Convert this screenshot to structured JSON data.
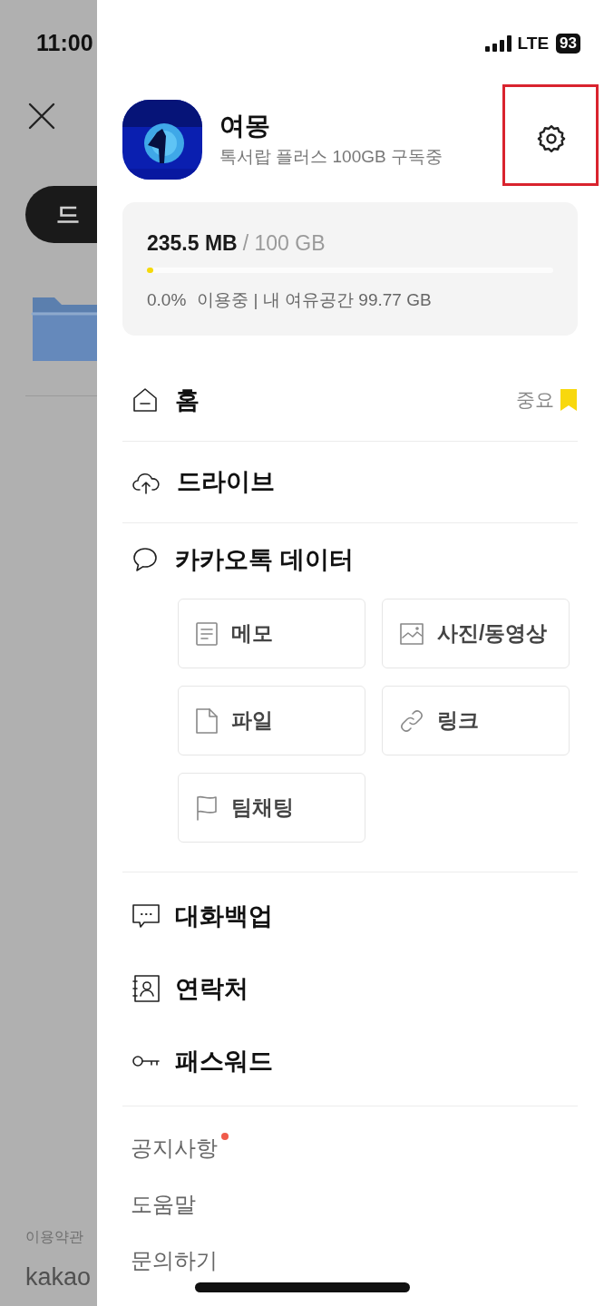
{
  "status_bar": {
    "time": "11:00",
    "network": "LTE",
    "battery": "93"
  },
  "background": {
    "tab": "드",
    "terms": "이용약관",
    "brand": "kakao"
  },
  "profile": {
    "name": "여몽",
    "subscription": "톡서랍 플러스 100GB 구독중"
  },
  "storage": {
    "used": "235.5 MB",
    "total": "/ 100 GB",
    "level": 0.002,
    "usage": "0.0%",
    "usage_label": "이용중 | 내 여유공간 99.77 GB"
  },
  "menu": [
    {
      "label": "홈",
      "badge": "중요"
    },
    {
      "label": "드라이브"
    },
    {
      "label": "카카오톡 데이터",
      "children": [
        {
          "label": "메모"
        },
        {
          "label": "사진/동영상"
        },
        {
          "label": "파일"
        },
        {
          "label": "링크"
        },
        {
          "label": "팀채팅"
        }
      ]
    }
  ],
  "tools": [
    {
      "label": "대화백업"
    },
    {
      "label": "연락처"
    },
    {
      "label": "패스워드"
    }
  ],
  "links": [
    {
      "label": "공지사항",
      "new": true
    },
    {
      "label": "도움말",
      "new": false
    },
    {
      "label": "문의하기",
      "new": false
    }
  ]
}
